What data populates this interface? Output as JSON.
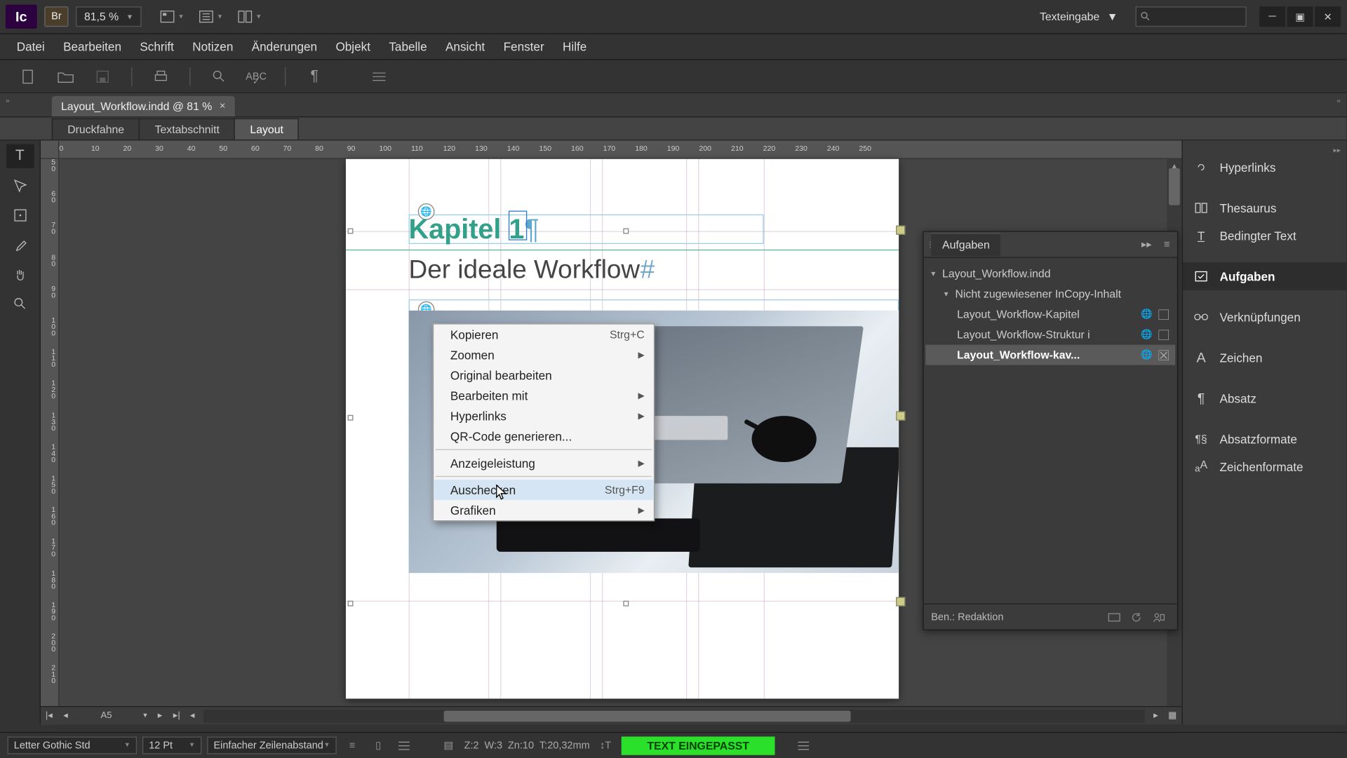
{
  "app": {
    "logo": "Ic",
    "bridge": "Br",
    "zoom": "81,5 %",
    "mode": "Texteingabe"
  },
  "menubar": [
    "Datei",
    "Bearbeiten",
    "Schrift",
    "Notizen",
    "Änderungen",
    "Objekt",
    "Tabelle",
    "Ansicht",
    "Fenster",
    "Hilfe"
  ],
  "file_tab": {
    "label": "Layout_Workflow.indd @ 81 %"
  },
  "view_tabs": [
    "Druckfahne",
    "Textabschnitt",
    "Layout"
  ],
  "hruler_ticks": [
    "0",
    "10",
    "20",
    "30",
    "40",
    "50",
    "60",
    "70",
    "80",
    "90",
    "100",
    "110",
    "120",
    "130",
    "140",
    "150",
    "160",
    "170",
    "180",
    "190",
    "200",
    "210",
    "220",
    "230",
    "240",
    "250"
  ],
  "vruler_ticks": [
    "50",
    "60",
    "70",
    "80",
    "90",
    "100",
    "110",
    "120",
    "130",
    "140",
    "150",
    "160",
    "170",
    "180",
    "190",
    "200",
    "210"
  ],
  "document": {
    "chapter": "Kapitel 1",
    "chapter_pilcrow": "¶",
    "subtitle": "Der ideale Workflow",
    "subtitle_hash": "#"
  },
  "context_menu": {
    "items": [
      {
        "label": "Kopieren",
        "shortcut": "Strg+C"
      },
      {
        "label": "Zoomen",
        "submenu": true
      },
      {
        "label": "Original bearbeiten"
      },
      {
        "label": "Bearbeiten mit",
        "submenu": true
      },
      {
        "label": "Hyperlinks",
        "submenu": true
      },
      {
        "label": "QR-Code generieren..."
      },
      {
        "sep": true
      },
      {
        "label": "Anzeigeleistung",
        "submenu": true
      },
      {
        "sep": true
      },
      {
        "label": "Auschecken",
        "shortcut": "Strg+F9",
        "highlight": true
      },
      {
        "label": "Grafiken",
        "submenu": true
      }
    ]
  },
  "assignments": {
    "title": "Aufgaben",
    "root": "Layout_Workflow.indd",
    "group": "Nicht zugewiesener InCopy-Inhalt",
    "items": [
      {
        "label": "Layout_Workflow-Kapitel",
        "checked": false
      },
      {
        "label": "Layout_Workflow-Struktur i",
        "checked": false
      },
      {
        "label": "Layout_Workflow-kav...",
        "checked": true,
        "selected": true
      }
    ],
    "footer_label": "Ben.: Redaktion"
  },
  "dock": [
    {
      "label": "Hyperlinks",
      "icon": "link"
    },
    {
      "sep": true
    },
    {
      "label": "Thesaurus",
      "icon": "book"
    },
    {
      "label": "Bedingter Text",
      "icon": "cond"
    },
    {
      "sep": true
    },
    {
      "label": "Aufgaben",
      "icon": "task",
      "active": true
    },
    {
      "sep": true
    },
    {
      "label": "Verknüpfungen",
      "icon": "chain"
    },
    {
      "sep": true
    },
    {
      "label": "Zeichen",
      "icon": "char"
    },
    {
      "sep": true
    },
    {
      "label": "Absatz",
      "icon": "para"
    },
    {
      "sep": true
    },
    {
      "label": "Absatzformate",
      "icon": "pfmt"
    },
    {
      "label": "Zeichenformate",
      "icon": "cfmt"
    }
  ],
  "pagenav": {
    "page_field": "A5"
  },
  "status": {
    "font": "Letter Gothic Std",
    "size": "12 Pt",
    "leading": "Einfacher Zeilenabstand",
    "z": "Z:2",
    "w": "W:3",
    "zn": "Zn:10",
    "t": "T:20,32mm",
    "badge": "TEXT EINGEPASST"
  }
}
